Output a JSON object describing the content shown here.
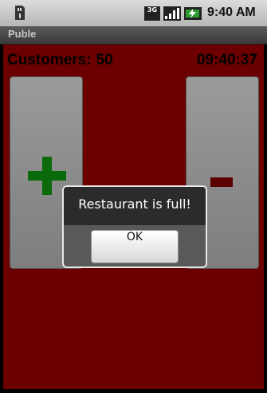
{
  "status_bar": {
    "network": "3G",
    "time": "9:40 AM",
    "icons": [
      "sd-card-icon",
      "3g-icon",
      "signal-icon",
      "battery-charging-icon"
    ]
  },
  "app": {
    "title": "Puble"
  },
  "counter": {
    "label": "Customers:",
    "value": "50",
    "clock": "09:40:37"
  },
  "buttons": {
    "add_icon": "plus-icon",
    "remove_icon": "minus-icon",
    "add_color": "#0b6a0b",
    "remove_color": "#5a0000"
  },
  "dialog": {
    "message": "Restaurant is full!",
    "ok_label": "OK"
  },
  "colors": {
    "background": "#6c0000",
    "plus": "#0b6a0b",
    "minus": "#5a0000"
  }
}
